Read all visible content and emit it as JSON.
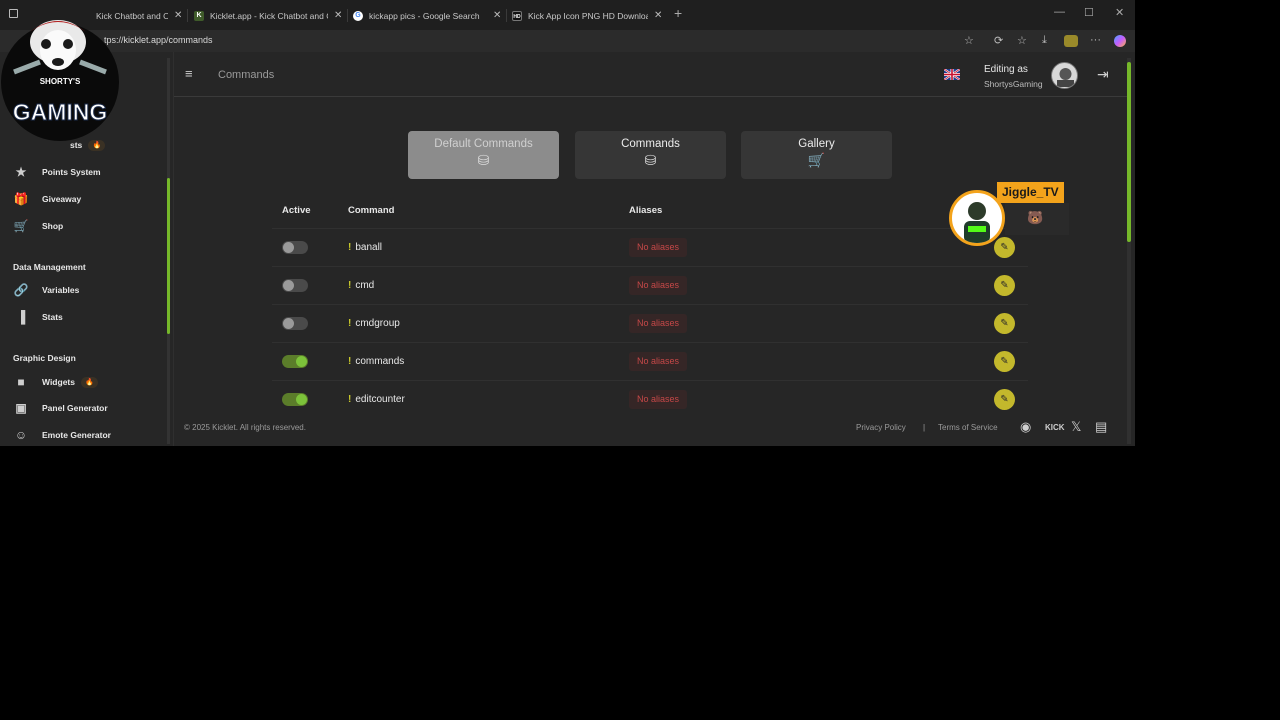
{
  "browser": {
    "tabs": [
      {
        "title": "Kick Chatbot and Ov",
        "favicon": "kicklet"
      },
      {
        "title": "Kicklet.app - Kick Chatbot and Ov",
        "favicon": "kicklet"
      },
      {
        "title": "kickapp pics - Google Search",
        "favicon": "google"
      },
      {
        "title": "Kick App Icon PNG HD Download",
        "favicon": "hd"
      }
    ],
    "url": "https://kicklet.app/commands",
    "url_visible": "tps://kicklet.app/commands"
  },
  "sidebar": {
    "partial_item": "sts",
    "items_points": "Points System",
    "items_giveaway": "Giveaway",
    "items_shop": "Shop",
    "section_data": "Data Management",
    "items_variables": "Variables",
    "items_stats": "Stats",
    "section_graphic": "Graphic Design",
    "items_widgets": "Widgets",
    "items_panel": "Panel Generator",
    "items_emote": "Emote Generator"
  },
  "header": {
    "title": "Commands",
    "editing_label": "Editing as",
    "username": "ShortysGaming"
  },
  "tabs": {
    "default": "Default Commands",
    "commands": "Commands",
    "gallery": "Gallery"
  },
  "table": {
    "col_active": "Active",
    "col_command": "Command",
    "col_aliases": "Aliases",
    "rows": [
      {
        "name": "banall",
        "active": false,
        "aliases": "No aliases"
      },
      {
        "name": "cmd",
        "active": false,
        "aliases": "No aliases"
      },
      {
        "name": "cmdgroup",
        "active": false,
        "aliases": "No aliases"
      },
      {
        "name": "commands",
        "active": true,
        "aliases": "No aliases"
      },
      {
        "name": "editcounter",
        "active": true,
        "aliases": "No aliases"
      }
    ]
  },
  "footer": {
    "copyright": "© 2025 Kicklet. All rights reserved.",
    "privacy": "Privacy Policy",
    "separator": "|",
    "terms": "Terms of Service",
    "kick": "KICK"
  },
  "overlay": {
    "logo_text": "GAMING",
    "logo_small": "SHORTY'S",
    "streamer": "Jiggle_TV"
  },
  "colors": {
    "accent": "#76b82a",
    "edit_button": "#c3b82c",
    "alias_text": "#c64848",
    "overlay_badge": "#f3a31b"
  }
}
